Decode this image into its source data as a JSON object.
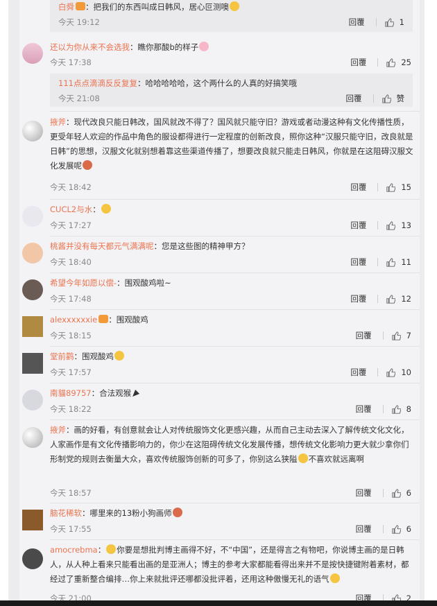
{
  "reply_label": "回覆",
  "comments": [
    {
      "name": "白舜",
      "text": "：把我们的东西叫成日韩风，居心叵测噢",
      "time": "今天 19:12",
      "likes": "1"
    },
    {
      "name": "还以为你从来不会选我",
      "text": "：瞧你那酸b的样子",
      "time": "今天 17:38",
      "likes": "25"
    },
    {
      "name": "111点点滴滴反反复复",
      "text": "：哈哈哈哈哈，这个两什么的人真的好搞笑哦",
      "time": "今天 21:08",
      "likes": "赞"
    },
    {
      "name": "掖斧",
      "text": "：现代改良只能日韩改，国风就改不得了？国风就只能守旧？游戏或者动漫这种有文化传播性质，更受年轻人欢迎的作品中角色的服设都得进行一定程度的创新改良，照你这种“汉服只能守旧，改良就是日韩”的思想，汉服文化就别想着靠这些渠道传播了，想要改良就只能走日韩风，你就是在这阻碍汉服文化发展呢",
      "time": "今天 18:42",
      "likes": "15"
    },
    {
      "name": "CUCL2与水",
      "text": "：",
      "time": "今天 17:27",
      "likes": "13"
    },
    {
      "name": "桃酱并没有每天都元气满满呢",
      "text": "：您是这些图的精神甲方？",
      "time": "今天 18:40",
      "likes": "11"
    },
    {
      "name": "希望今年如愿以偿-",
      "text": "：围观酸鸡啦~",
      "time": "今天 17:48",
      "likes": "12"
    },
    {
      "name": "alexxxxxxie",
      "text": "：围观酸鸡",
      "time": "今天 18:15",
      "likes": "7"
    },
    {
      "name": "堂前鹳",
      "text": "：围观酸鸡",
      "time": "今天 17:57",
      "likes": "10"
    },
    {
      "name": "南貓89757",
      "text": "：合法观猴",
      "time": "今天 18:22",
      "likes": "8"
    },
    {
      "name": "掖斧",
      "text": "：画的好看，有创意就会让人对传统服饰文化更感兴趣，从而自己主动去深入了解传统文化文化，人家画作是有文化传播影响力的，你少在这阻碍传统文化发展传播，想传统文化影响力更大就少拿你们形制党的规则去衡量大众，喜欢传统服饰创新的可多了，你别这么狭隘",
      "text2": "不喜欢就远离啊",
      "time": "今天 18:57",
      "likes": "6"
    },
    {
      "name": "脑花稀软",
      "text": "：哪里来的13粉小狗画师",
      "time": "今天 17:55",
      "likes": "6"
    },
    {
      "name": "amocrebma",
      "text": "：",
      "text2": "你要是想批判博主画得不好，不“中国”，还是得言之有物吧，你说博主画的是日韩人，从人种上看来只能看出画的是亚洲人；博主的参考大家都能看得出来并不是按快捷键附着素材，都经过了重新整合编排…你上来就批评还哪都没批评着，还用这种傲慢无礼的语气",
      "time": "今天 21:00",
      "likes": "2"
    }
  ]
}
